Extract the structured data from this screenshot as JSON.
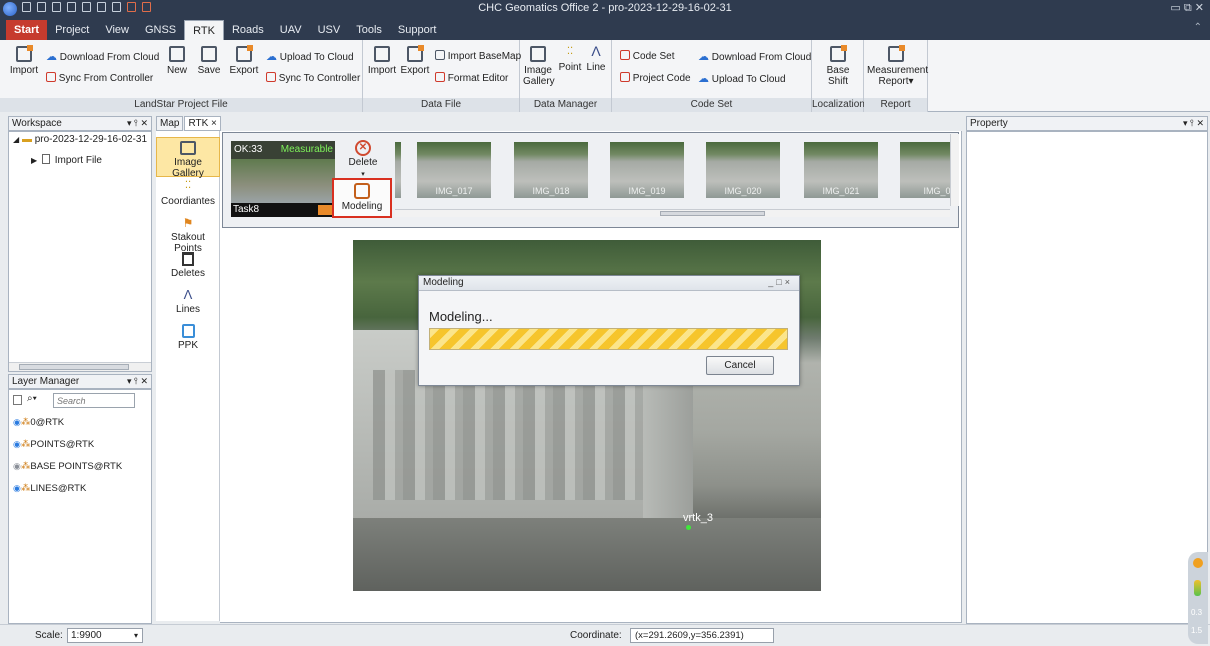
{
  "window": {
    "title": "CHC Geomatics Office 2 - pro-2023-12-29-16-02-31",
    "controls": "▭ ⧉ ✕"
  },
  "menu": [
    "Start",
    "Project",
    "View",
    "GNSS",
    "RTK",
    "Roads",
    "UAV",
    "USV",
    "Tools",
    "Support"
  ],
  "ribbon": {
    "landstar": {
      "label": "LandStar Project File",
      "import": "Import",
      "download_cloud": "Download From Cloud",
      "sync_from_controller": "Sync From Controller",
      "new": "New",
      "save": "Save",
      "export": "Export",
      "upload_cloud": "Upload To Cloud",
      "sync_to_controller": "Sync To Controller"
    },
    "datafile": {
      "label": "Data File",
      "import": "Import",
      "export": "Export",
      "import_basemap": "Import BaseMap",
      "format_editor": "Format Editor"
    },
    "datamanager": {
      "label": "Data Manager",
      "image_gallery": "Image Gallery",
      "point": "Point",
      "line": "Line"
    },
    "codeset": {
      "label": "Code Set",
      "code_set": "Code Set",
      "project_code": "Project Code",
      "download_cloud": "Download From Cloud",
      "upload_cloud": "Upload To Cloud"
    },
    "localization": {
      "label": "Localization",
      "base_shift": "Base Shift"
    },
    "report": {
      "label": "Report",
      "measurement_report": "Measurement Report▾"
    }
  },
  "workspace": {
    "title": "Workspace",
    "controls": "▾ ⫯ ✕",
    "project": "pro-2023-12-29-16-02-31",
    "import_file": "Import File"
  },
  "layers": {
    "title": "Layer Manager",
    "controls": "▾ ⫯ ✕",
    "search_placeholder": "Search",
    "items": [
      "0@RTK",
      "POINTS@RTK",
      "BASE POINTS@RTK",
      "LINES@RTK"
    ]
  },
  "tabs": [
    "Map",
    "RTK ×"
  ],
  "tools": [
    "Image Gallery",
    "Coordiantes",
    "Stakout Points",
    "Deletes",
    "Lines",
    "PPK"
  ],
  "gallery": {
    "ok": "OK:33",
    "measurable": "Measurable",
    "task": "Task8",
    "delete": "Delete",
    "modeling": "Modeling",
    "thumbs": [
      "",
      "IMG_017",
      "IMG_018",
      "IMG_019",
      "IMG_020",
      "IMG_021",
      "IMG_0"
    ]
  },
  "photo": {
    "point_label": "vrtk_3"
  },
  "modal": {
    "title": "Modeling",
    "message": "Modeling...",
    "cancel": "Cancel",
    "progress": 1.0
  },
  "property": {
    "title": "Property",
    "controls": "▾ ⫯ ✕"
  },
  "status": {
    "scale_label": "Scale:",
    "scale_value": "1:9900",
    "coord_label": "Coordinate:",
    "coord_value": "(x=291.2609,y=356.2391)"
  },
  "sidewidget": {
    "v1": "0.3",
    "v2": "1.5"
  }
}
